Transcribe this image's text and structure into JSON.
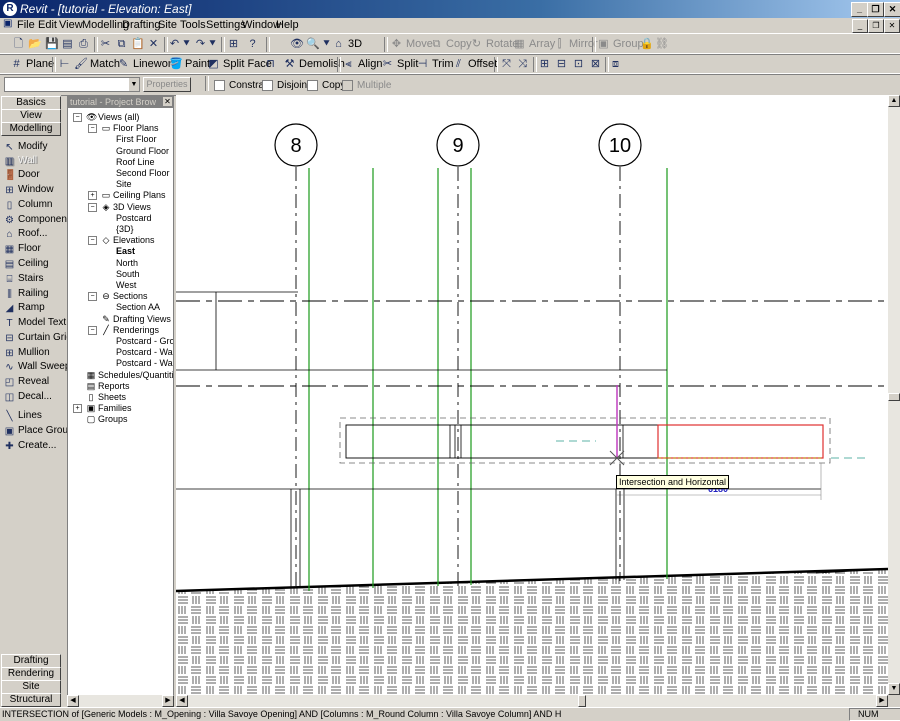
{
  "window": {
    "title": "Revit - [tutorial - Elevation: East]",
    "logo": "R"
  },
  "menu": [
    "File",
    "Edit",
    "View",
    "Modelling",
    "Drafting",
    "Site",
    "Tools",
    "Settings",
    "Window",
    "Help"
  ],
  "toolbar1": {
    "move": "Move",
    "copy": "Copy",
    "rotate": "Rotate",
    "array": "Array",
    "mirror": "Mirror",
    "group": "Group",
    "view3d": "3D"
  },
  "toolbar2": {
    "plane": "Plane",
    "match": "Match",
    "linework": "Linework",
    "paint": "Paint",
    "split_face": "Split Face",
    "demolish": "Demolish",
    "align": "Align",
    "split": "Split",
    "trim": "Trim",
    "offset": "Offset"
  },
  "optionsbar": {
    "type_value": "",
    "properties": "Properties",
    "constrain": "Constrain",
    "disjoin": "Disjoin",
    "copy": "Copy",
    "multiple": "Multiple"
  },
  "designbar": {
    "tabs_top": [
      "Basics",
      "View",
      "Modelling"
    ],
    "items": [
      {
        "icon": "arrow-icon",
        "label": "Modify"
      },
      {
        "icon": "wall-icon",
        "label": "Wall",
        "disabled": true
      },
      {
        "icon": "door-icon",
        "label": "Door"
      },
      {
        "icon": "window-icon",
        "label": "Window"
      },
      {
        "icon": "column-icon",
        "label": "Column"
      },
      {
        "icon": "component-icon",
        "label": "Component"
      },
      {
        "icon": "roof-icon",
        "label": "Roof..."
      },
      {
        "icon": "floor-icon",
        "label": "Floor"
      },
      {
        "icon": "ceiling-icon",
        "label": "Ceiling"
      },
      {
        "icon": "stairs-icon",
        "label": "Stairs"
      },
      {
        "icon": "railing-icon",
        "label": "Railing"
      },
      {
        "icon": "ramp-icon",
        "label": "Ramp"
      },
      {
        "icon": "model-text-icon",
        "label": "Model Text"
      },
      {
        "icon": "curtain-grid-icon",
        "label": "Curtain Grid"
      },
      {
        "icon": "mullion-icon",
        "label": "Mullion"
      },
      {
        "icon": "wall-sweep-icon",
        "label": "Wall Sweep"
      },
      {
        "icon": "reveal-icon",
        "label": "Reveal"
      },
      {
        "icon": "decal-icon",
        "label": "Decal..."
      },
      {
        "icon": "lines-icon",
        "label": "Lines"
      },
      {
        "icon": "place-group-icon",
        "label": "Place Group"
      },
      {
        "icon": "create-icon",
        "label": "Create..."
      }
    ],
    "tabs_bottom": [
      "Drafting",
      "Rendering",
      "Site",
      "Structural"
    ]
  },
  "browser": {
    "title": "tutorial - Project Brow",
    "nodes": [
      {
        "t": "Views (all)",
        "lvl": 0,
        "pm": "-",
        "icon": "eye-icon"
      },
      {
        "t": "Floor Plans",
        "lvl": 1,
        "pm": "-",
        "icon": "floorplan-icon"
      },
      {
        "t": "First Floor",
        "lvl": 2
      },
      {
        "t": "Ground Floor",
        "lvl": 2
      },
      {
        "t": "Roof Line",
        "lvl": 2
      },
      {
        "t": "Second Floor",
        "lvl": 2
      },
      {
        "t": "Site",
        "lvl": 2
      },
      {
        "t": "Ceiling Plans",
        "lvl": 1,
        "pm": "+",
        "icon": "ceilingplan-icon"
      },
      {
        "t": "3D Views",
        "lvl": 1,
        "pm": "-",
        "icon": "cube-icon"
      },
      {
        "t": "Postcard",
        "lvl": 2
      },
      {
        "t": "{3D}",
        "lvl": 2
      },
      {
        "t": "Elevations",
        "lvl": 1,
        "pm": "-",
        "icon": "elevation-icon"
      },
      {
        "t": "East",
        "lvl": 2,
        "bold": true
      },
      {
        "t": "North",
        "lvl": 2
      },
      {
        "t": "South",
        "lvl": 2
      },
      {
        "t": "West",
        "lvl": 2
      },
      {
        "t": "Sections",
        "lvl": 1,
        "pm": "-",
        "icon": "section-icon"
      },
      {
        "t": "Section AA",
        "lvl": 2
      },
      {
        "t": "Drafting Views",
        "lvl": 1,
        "icon": "drafting-icon"
      },
      {
        "t": "Renderings",
        "lvl": 1,
        "pm": "-",
        "icon": "rendering-icon"
      },
      {
        "t": "Postcard - Grou",
        "lvl": 2
      },
      {
        "t": "Postcard - Wall-",
        "lvl": 2
      },
      {
        "t": "Postcard - Wall-",
        "lvl": 2
      },
      {
        "t": "Schedules/Quantitie",
        "lvl": 0,
        "icon": "schedule-icon"
      },
      {
        "t": "Reports",
        "lvl": 0,
        "icon": "report-icon"
      },
      {
        "t": "Sheets",
        "lvl": 0,
        "icon": "sheet-icon"
      },
      {
        "t": "Families",
        "lvl": 0,
        "pm": "+",
        "icon": "family-icon"
      },
      {
        "t": "Groups",
        "lvl": 0,
        "icon": "group-icon"
      }
    ]
  },
  "canvas": {
    "grid_labels": [
      "8",
      "9",
      "10"
    ],
    "tooltip": "Intersection and Horizontal",
    "dimension": "6180"
  },
  "status": {
    "text": "INTERSECTION  of [Generic Models : M_Opening : Villa Savoye Opening] AND [Columns : M_Round Column : Villa Savoye Column] AND H",
    "num": "NUM"
  },
  "colors": {
    "titlebar": "#0a246a",
    "grid_green": "#1a9a1a",
    "select_red": "#e03030",
    "dim_blue": "#2020c0"
  }
}
